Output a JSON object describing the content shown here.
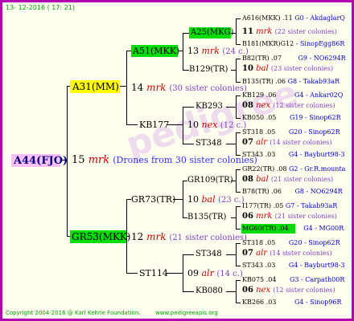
{
  "header": {
    "date": "13- 12-2016 ( 17: 21)"
  },
  "footer": {
    "copyright": "Copyright 2004-2016 @ Karl Kehrle Foundation.",
    "url": "www.pedigreeapis.org"
  },
  "colors": {
    "border": "#b000b0",
    "root_bg": "#ffc0ff",
    "yellow_bg": "#ffff00",
    "green_bg": "#00dd00",
    "mrk_red": "#cc0000",
    "blue": "#0000cc",
    "grey": "#8040c0"
  },
  "root": {
    "id": "A44(FJO)",
    "gen": "15",
    "mark": "mrk",
    "note": "(Drones from 30 sister colonies)"
  },
  "mother": {
    "id": "A31(MM)",
    "gen": "14",
    "mark": "mrk",
    "note": "(30 sister colonies)"
  },
  "father": {
    "id": "GR53(MKK)",
    "gen": "12",
    "mark": "mrk",
    "note": "(21 sister colonies)"
  },
  "m_mother": {
    "id": "A51(MKK)",
    "gen": "13",
    "mark": "mrk",
    "note": "(24 c.)"
  },
  "m_father": {
    "id": "KB177",
    "gen": "10",
    "mark": "nex",
    "note": "(12 c.)"
  },
  "f_mother": {
    "id": "GR73(TR)",
    "gen": "10",
    "mark": "bal",
    "note": "(23 c.)"
  },
  "f_father": {
    "id": "ST114",
    "gen": "09",
    "mark": "alr",
    "note": "(14 c.)"
  },
  "g3": {
    "a25": {
      "id": "A25(MKG)",
      "gen": "11",
      "mark": "mrk",
      "note": "(22 sister colonies)"
    },
    "b129": {
      "id": "B129(TR)",
      "gen": "10",
      "mark": "bal",
      "note": "(23 sister colonies)"
    },
    "kb293": {
      "id": "KB293",
      "gen": "08",
      "mark": "nex",
      "note": "(12 sister colonies)"
    },
    "st348a": {
      "id": "ST348",
      "gen": "07",
      "mark": "alr",
      "note": "(14 sister colonies)"
    },
    "gr109": {
      "id": "GR109(TR)",
      "gen": "08",
      "mark": "bal",
      "note": "(21 sister colonies)"
    },
    "b135": {
      "id": "B135(TR)",
      "gen": "06",
      "mark": "mrk",
      "note": "(21 sister colonies)"
    },
    "st348b": {
      "id": "ST348",
      "gen": "07",
      "mark": "alr",
      "note": "(14 sister colonies)"
    },
    "kb080": {
      "id": "KB080",
      "gen": "06",
      "mark": "nex",
      "note": "(12 sister colonies)"
    }
  },
  "g4": [
    {
      "left": "A616(MKK) .11",
      "right": "G0 - AkdaglarQ"
    },
    {
      "left": "B181(MKR)G12",
      "right": "- SinopEgg86R"
    },
    {
      "left": "B82(TR) .07",
      "right": "G9 - NO6294R"
    },
    {
      "left": "B135(TR) .06",
      "right": "G8 - Takab93aR"
    },
    {
      "left": "KB129 .06",
      "right": "G4 - Ankar02Q"
    },
    {
      "left": "KB050 .05",
      "right": "G19 - Sinop62R"
    },
    {
      "left": "ST318 .05",
      "right": "G20 - Sinop62R"
    },
    {
      "left": "ST343 .03",
      "right": "G4 - Bayburt98-3"
    },
    {
      "left": "GR22(TR) .08",
      "right": "G2 - Gr.R.mounta"
    },
    {
      "left": "B78(TR) .06",
      "right": "G8 - NO6294R"
    },
    {
      "left": "I177(TR) .05",
      "right": "G7 - Takab93aR"
    },
    {
      "left": "MG60(TR) .04",
      "right": "G4 - MG00R"
    },
    {
      "left": "ST318 .05",
      "right": "G20 - Sinop62R"
    },
    {
      "left": "ST343 .03",
      "right": "G4 - Bayburt98-3"
    },
    {
      "left": "KB075 .04",
      "right": "G3 - Carpath00R"
    },
    {
      "left": "KB266 .03",
      "right": "G4 - Sinop96R"
    }
  ]
}
